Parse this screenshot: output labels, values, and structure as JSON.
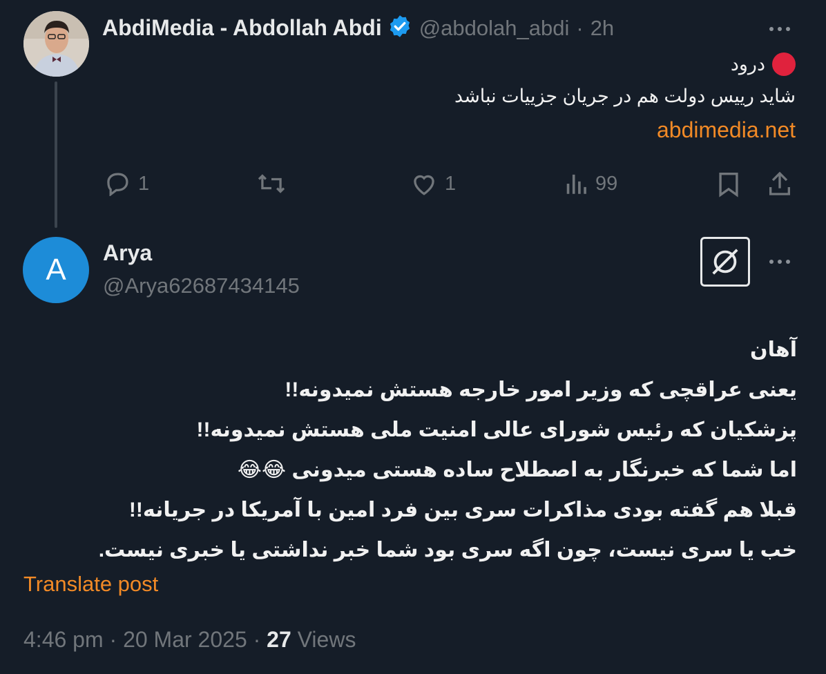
{
  "tweet1": {
    "display_name": "AbdiMedia - Abdollah Abdi",
    "handle": "@abdolah_abdi",
    "separator": "·",
    "time": "2h",
    "lines": [
      "درود",
      "شاید رییس دولت هم در جریان جزییات نباشد"
    ],
    "link": "abdimedia.net",
    "actions": {
      "replies": "1",
      "reposts": "",
      "likes": "1",
      "views": "99"
    }
  },
  "tweet2": {
    "avatar_letter": "A",
    "display_name": "Arya",
    "handle": "@Arya62687434145",
    "lines": [
      "آهان",
      "یعنی عراقچی که وزیر امور خارجه هستش نمیدونه!!",
      "پزشکیان که رئیس شورای عالی امنیت ملی هستش نمیدونه!!",
      "اما شما که خبرنگار به اصطلاح ساده هستی میدونی 😂😂",
      "قبلا هم گفته بودی مذاکرات سری بین فرد امین با آمریکا در جریانه!!",
      "خب یا سری نیست، چون اگه سری بود شما خبر نداشتی یا خبری نیست."
    ],
    "translate_label": "Translate post",
    "time": "4:46 pm",
    "date": "20 Mar 2025",
    "views_count": "27",
    "views_label": "Views"
  },
  "colors": {
    "background": "#151d28",
    "accent_link": "#f28a26",
    "verified_badge": "#1d9bf0",
    "avatar_bg": "#1d8cd8",
    "red_dot": "#e0223d"
  },
  "icons": [
    "verified-badge-icon",
    "more-icon",
    "reply-icon",
    "repost-icon",
    "like-icon",
    "views-icon",
    "bookmark-icon",
    "share-icon",
    "grok-icon",
    "red-circle-emoji"
  ]
}
